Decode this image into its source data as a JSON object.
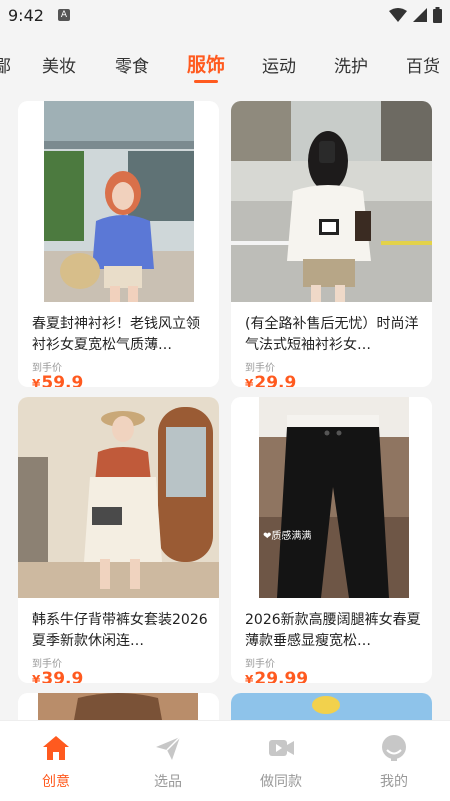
{
  "status": {
    "time": "9:42",
    "notif": "A"
  },
  "tabs": [
    {
      "label": "鄙"
    },
    {
      "label": "美妆"
    },
    {
      "label": "零食"
    },
    {
      "label": "服饰"
    },
    {
      "label": "运动"
    },
    {
      "label": "洗护"
    },
    {
      "label": "百货"
    }
  ],
  "active_tab": "服饰",
  "products": [
    {
      "title": "春夏封神衬衫！老钱风立领衬衫女夏宽松气质薄…",
      "price_label": "到手价",
      "currency": "¥",
      "price": "59.9"
    },
    {
      "title": "(有全路补售后无忧）时尚洋气法式短袖衬衫女…",
      "price_label": "到手价",
      "currency": "¥",
      "price": "29.9"
    },
    {
      "title": "韩系牛仔背带裤女套装2026夏季新款休闲连…",
      "price_label": "到手价",
      "currency": "¥",
      "price": "39.9"
    },
    {
      "title": "2026新款高腰阔腿裤女春夏薄款垂感显瘦宽松…",
      "price_label": "到手价",
      "currency": "¥",
      "price": "29.99",
      "overlay_text": "❤质感满满"
    }
  ],
  "bottom_nav": [
    {
      "label": "创意",
      "icon": "home-icon",
      "active": true
    },
    {
      "label": "选品",
      "icon": "paper-plane-icon",
      "active": false
    },
    {
      "label": "做同款",
      "icon": "video-icon",
      "active": false
    },
    {
      "label": "我的",
      "icon": "profile-icon",
      "active": false
    }
  ],
  "colors": {
    "accent": "#ff5a1f",
    "inactive": "#999999",
    "background": "#f4f4f4"
  }
}
